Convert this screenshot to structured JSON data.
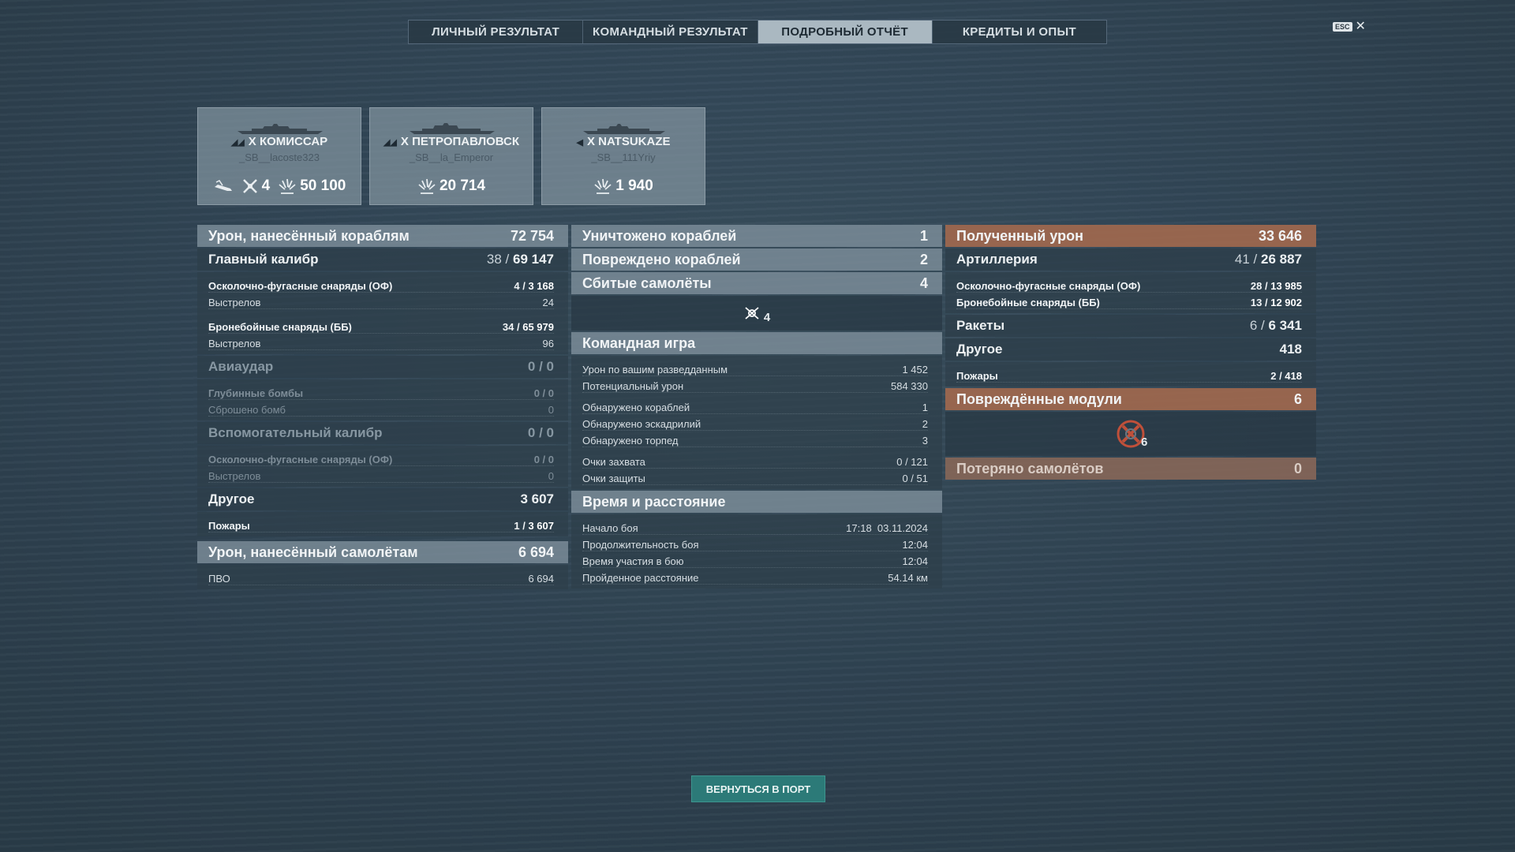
{
  "tabs": [
    "ЛИЧНЫЙ РЕЗУЛЬТАТ",
    "КОМАНДНЫЙ РЕЗУЛЬТАТ",
    "ПОДРОБНЫЙ ОТЧЁТ",
    "КРЕДИТЫ И ОПЫТ"
  ],
  "active_tab": "ПОДРОБНЫЙ ОТЧЁТ",
  "esc": {
    "key": "ESC",
    "close": "✕"
  },
  "ships": [
    {
      "tier": "X",
      "name": "КОМИССАР",
      "player": "_SB__lacoste323",
      "stats": {
        "kills": "4",
        "damage": "50 100"
      }
    },
    {
      "tier": "X",
      "name": "ПЕТРОПАВЛОВСК",
      "player": "_SB__la_Emperor",
      "stats": {
        "damage": "20 714"
      }
    },
    {
      "tier": "X",
      "name": "NATSUKAZE",
      "player": "_SB__111Yriy",
      "stats": {
        "damage": "1 940"
      }
    }
  ],
  "left": {
    "header": {
      "label": "Урон, нанесённый кораблям",
      "value": "72 754"
    },
    "main_caliber": {
      "label": "Главный калибр",
      "hits": "38",
      "damage": "69 147"
    },
    "he": {
      "label": "Осколочно-фугасные снаряды (ОФ)",
      "hits": "4",
      "damage": "3 168",
      "shots_label": "Выстрелов",
      "shots": "24"
    },
    "ap": {
      "label": "Бронебойные снаряды (ББ)",
      "hits": "34",
      "damage": "65 979",
      "shots_label": "Выстрелов",
      "shots": "96"
    },
    "airstrike": {
      "label": "Авиаудар",
      "value": "0 / 0"
    },
    "depth": {
      "label": "Глубинные бомбы",
      "value": "0 / 0",
      "dropped_label": "Сброшено бомб",
      "dropped": "0"
    },
    "secondary": {
      "label": "Вспомогательный калибр",
      "value": "0 / 0"
    },
    "sec_he": {
      "label": "Осколочно-фугасные снаряды (ОФ)",
      "value": "0 / 0",
      "shots_label": "Выстрелов",
      "shots": "0"
    },
    "other": {
      "label": "Другое",
      "value": "3 607"
    },
    "fires": {
      "label": "Пожары",
      "count": "1",
      "damage": "3 607"
    },
    "aircraft_header": {
      "label": "Урон, нанесённый самолётам",
      "value": "6 694"
    },
    "aa": {
      "label": "ПВО",
      "value": "6 694"
    }
  },
  "middle": {
    "destroyed": {
      "label": "Уничтожено кораблей",
      "value": "1"
    },
    "damaged": {
      "label": "Повреждено кораблей",
      "value": "2"
    },
    "planes": {
      "label": "Сбитые самолёты",
      "value": "4",
      "icon_count": "4"
    },
    "team_header": "Командная игра",
    "team": [
      {
        "label": "Урон по вашим разведданным",
        "value": "1 452"
      },
      {
        "label": "Потенциальный урон",
        "value": "584 330"
      },
      {
        "label": "Обнаружено кораблей",
        "value": "1"
      },
      {
        "label": "Обнаружено эскадрилий",
        "value": "2"
      },
      {
        "label": "Обнаружено торпед",
        "value": "3"
      },
      {
        "label": "Очки захвата",
        "value": "0 / 121"
      },
      {
        "label": "Очки защиты",
        "value": "0 / 51"
      }
    ],
    "time_header": "Время и расстояние",
    "time": [
      {
        "label": "Начало боя",
        "value": "17:18  03.11.2024"
      },
      {
        "label": "Продолжительность боя",
        "value": "12:04"
      },
      {
        "label": "Время участия в бою",
        "value": "12:04"
      },
      {
        "label": "Пройденное расстояние",
        "value": "54.14 км"
      }
    ]
  },
  "right": {
    "header": {
      "label": "Полученный урон",
      "value": "33 646"
    },
    "artillery": {
      "label": "Артиллерия",
      "hits": "41",
      "damage": "26 887"
    },
    "he": {
      "label": "Осколочно-фугасные снаряды (ОФ)",
      "hits": "28",
      "damage": "13 985"
    },
    "ap": {
      "label": "Бронебойные снаряды (ББ)",
      "hits": "13",
      "damage": "12 902"
    },
    "rockets": {
      "label": "Ракеты",
      "hits": "6",
      "damage": "6 341"
    },
    "other": {
      "label": "Другое",
      "value": "418"
    },
    "fires": {
      "label": "Пожары",
      "count": "2",
      "damage": "418"
    },
    "modules": {
      "label": "Повреждённые модули",
      "value": "6",
      "icon_count": "6"
    },
    "planes_lost": {
      "label": "Потеряно самолётов",
      "value": "0"
    }
  },
  "button": {
    "label": "ВЕРНУТЬСЯ В ПОРТ"
  },
  "colors": {
    "accent_orange": "#a0684e",
    "button_teal": "#2c7a78",
    "active_tab": "#aab8c1"
  }
}
